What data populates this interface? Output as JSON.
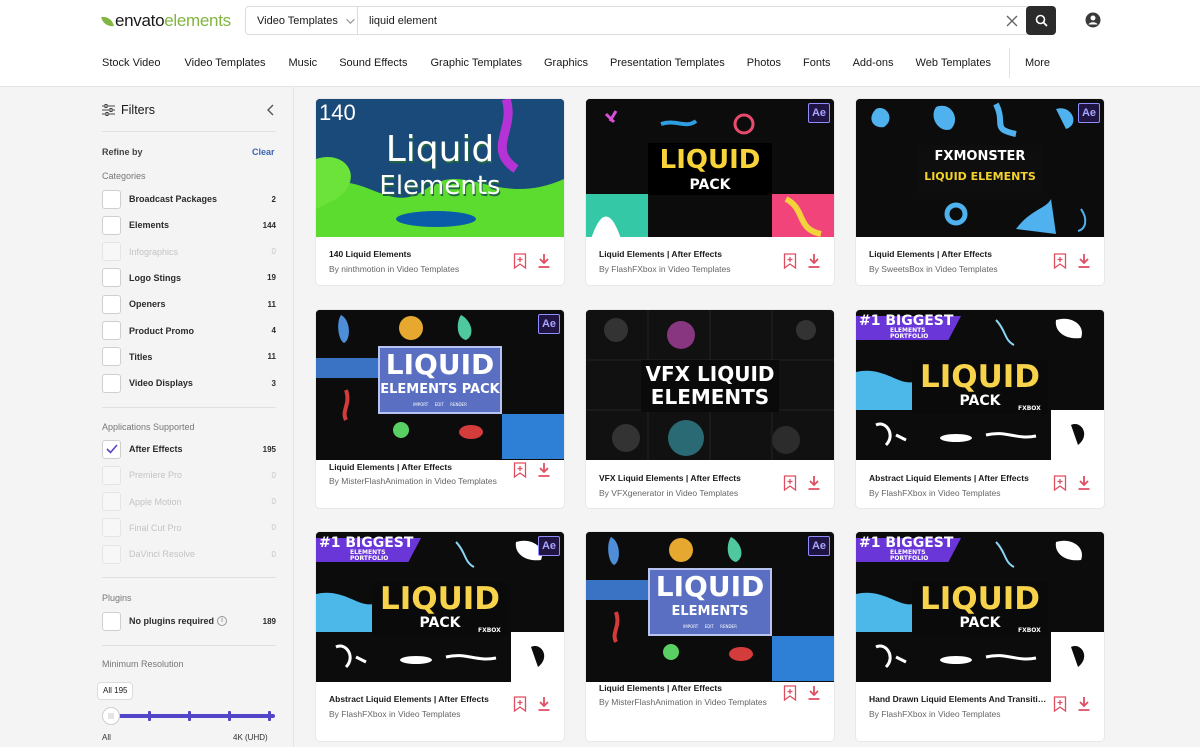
{
  "header": {
    "logo_envato": "envato",
    "logo_elements": "elements",
    "search_category": "Video Templates",
    "search_value": "liquid element"
  },
  "nav": [
    "Stock Video",
    "Video Templates",
    "Music",
    "Sound Effects",
    "Graphic Templates",
    "Graphics",
    "Presentation Templates",
    "Photos",
    "Fonts",
    "Add-ons",
    "Web Templates",
    "More"
  ],
  "sidebar": {
    "title": "Filters",
    "refine_by": "Refine by",
    "clear": "Clear",
    "categories_label": "Categories",
    "categories": [
      {
        "label": "Broadcast Packages",
        "count": "2",
        "enabled": true
      },
      {
        "label": "Elements",
        "count": "144",
        "enabled": true
      },
      {
        "label": "Infographics",
        "count": "0",
        "enabled": false
      },
      {
        "label": "Logo Stings",
        "count": "19",
        "enabled": true
      },
      {
        "label": "Openers",
        "count": "11",
        "enabled": true
      },
      {
        "label": "Product Promo",
        "count": "4",
        "enabled": true
      },
      {
        "label": "Titles",
        "count": "11",
        "enabled": true
      },
      {
        "label": "Video Displays",
        "count": "3",
        "enabled": true
      }
    ],
    "apps_label": "Applications Supported",
    "apps": [
      {
        "label": "After Effects",
        "count": "195",
        "enabled": true,
        "checked": true
      },
      {
        "label": "Premiere Pro",
        "count": "0",
        "enabled": false
      },
      {
        "label": "Apple Motion",
        "count": "0",
        "enabled": false
      },
      {
        "label": "Final Cut Pro",
        "count": "0",
        "enabled": false
      },
      {
        "label": "DaVinci Resolve",
        "count": "0",
        "enabled": false
      }
    ],
    "plugins_label": "Plugins",
    "plugins": [
      {
        "label": "No plugins required",
        "count": "189",
        "enabled": true
      }
    ],
    "resolution_label": "Minimum Resolution",
    "resolution_tip": "All 195",
    "resolution_min": "All",
    "resolution_max": "4K (UHD)"
  },
  "cards": [
    {
      "title": "140 Liquid Elements",
      "by": "By ninthmotion in Video Templates",
      "art": {
        "type": "liquid-green",
        "line1": "Liquid",
        "line2": "Elements",
        "corner": "140"
      }
    },
    {
      "title": "Liquid Elements | After Effects",
      "by": "By FlashFXbox in Video Templates",
      "art": {
        "type": "liquid-yellow-box",
        "line1": "LIQUID",
        "line2": "PACK",
        "badge": "Ae"
      }
    },
    {
      "title": "Liquid Elements | After Effects",
      "by": "By SweetsBox in Video Templates",
      "art": {
        "type": "fxmonster",
        "line1": "FXMONSTER",
        "line2": "LIQUID ELEMENTS",
        "badge": "Ae"
      }
    },
    {
      "title": "Liquid Elements | After Effects",
      "by": "By MisterFlashAnimation in Video Templates",
      "art": {
        "type": "blue-pack",
        "line1": "LIQUID",
        "line2": "ELEMENTS PACK",
        "sub": "IMPORT     EDIT     RENDER",
        "badge": "Ae"
      }
    },
    {
      "title": "VFX Liquid Elements | After Effects",
      "by": "By VFXgenerator in Video Templates",
      "art": {
        "type": "vfx",
        "line1": "VFX LIQUID",
        "line2": "ELEMENTS"
      }
    },
    {
      "title": "Abstract Liquid Elements | After Effects",
      "by": "By FlashFXbox in Video Templates",
      "art": {
        "type": "biggest",
        "banner": "#1 BIGGEST",
        "banner2": "ELEMENTS",
        "banner3": "PORTFOLIO",
        "line1": "LIQUID",
        "line2": "PACK",
        "brand": "FXBOX"
      }
    },
    {
      "title": "Abstract Liquid Elements | After Effects",
      "by": "By FlashFXbox in Video Templates",
      "art": {
        "type": "biggest",
        "banner": "#1 BIGGEST",
        "banner2": "ELEMENTS",
        "banner3": "PORTFOLIO",
        "line1": "LIQUID",
        "line2": "PACK",
        "brand": "FXBOX",
        "badge": "Ae"
      }
    },
    {
      "title": "Liquid Elements | After Effects",
      "by": "By MisterFlashAnimation in Video Templates",
      "art": {
        "type": "blue-pack",
        "line1": "LIQUID",
        "line2": "ELEMENTS",
        "sub": "IMPORT     EDIT     RENDER",
        "badge": "Ae"
      }
    },
    {
      "title": "Hand Drawn Liquid Elements And Transitions",
      "by": "By FlashFXbox in Video Templates",
      "art": {
        "type": "biggest",
        "banner": "#1 BIGGEST",
        "banner2": "ELEMENTS",
        "banner3": "PORTFOLIO",
        "line1": "LIQUID",
        "line2": "PACK",
        "brand": "FXBOX"
      }
    }
  ],
  "colors": {
    "accent": "#82b541",
    "action": "#e04e62",
    "slider": "#5245c7",
    "link": "#3b64b3"
  }
}
